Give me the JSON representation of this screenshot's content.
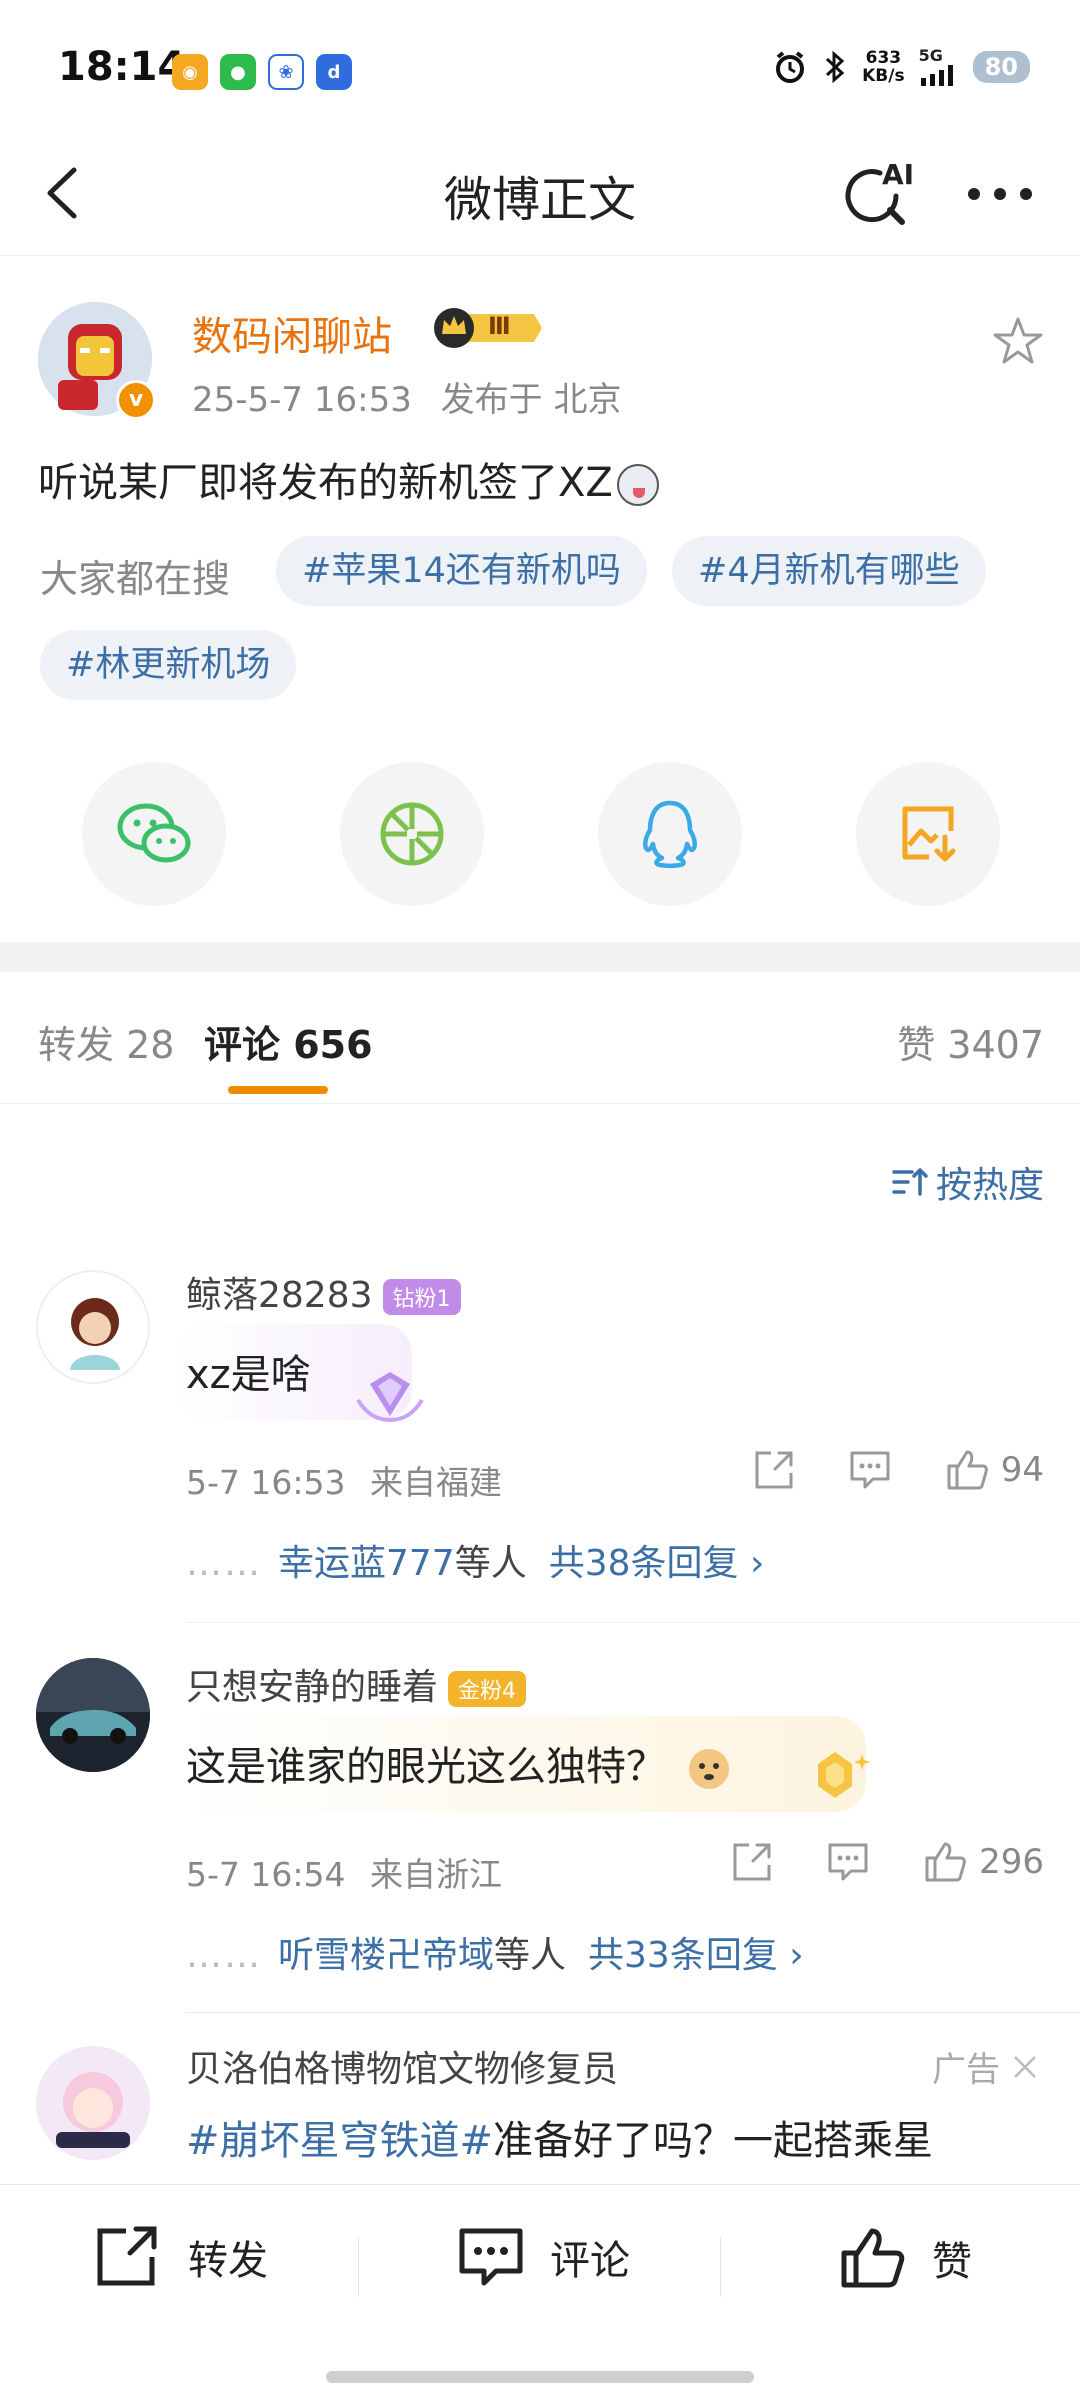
{
  "status_bar": {
    "time": "18:14",
    "net_speed_value": "633",
    "net_speed_unit": "KB/s",
    "signal": "5G",
    "battery": "80"
  },
  "header": {
    "title": "微博正文",
    "ai_label": "AI"
  },
  "post": {
    "author": "数码闲聊站",
    "badge_level": "Ⅲ",
    "verified_mark": "v",
    "date": "25-5-7 16:53",
    "location": "发布于 北京",
    "text": "听说某厂即将发布的新机签了XZ",
    "search_label": "大家都在搜",
    "tags": [
      "#苹果14还有新机吗",
      "#4月新机有哪些",
      "#林更新机场"
    ]
  },
  "tabs": {
    "repost": "转发 28",
    "comments": "评论 656",
    "likes": "赞 3407"
  },
  "sort": {
    "label": "按热度"
  },
  "comments": [
    {
      "user": "鲸落28283",
      "badge": "钻粉1",
      "text": "xz是啥",
      "time": "5-7 16:53",
      "location": "来自福建",
      "likes": "94",
      "reply_users": "幸运蓝777",
      "reply_mid": "等人",
      "reply_total": "共38条回复 ›",
      "dots": "……"
    },
    {
      "user": "只想安静的睡着",
      "badge": "金粉4",
      "text": "这是谁家的眼光这么独特？",
      "time": "5-7 16:54",
      "location": "来自浙江",
      "likes": "296",
      "reply_users": "听雪楼卍帝域",
      "reply_mid": "等人",
      "reply_total": "共33条回复 ›",
      "dots": "……"
    }
  ],
  "ad": {
    "user": "贝洛伯格博物馆文物修复员",
    "label": "广告",
    "topic": "#崩坏星穹铁道#",
    "text": "准备好了吗？一起搭乘星"
  },
  "bottom_bar": {
    "repost": "转发",
    "comment": "评论",
    "like": "赞"
  },
  "colors": {
    "accent": "#f08a00",
    "link": "#3c6fa6",
    "author": "#e8720c"
  }
}
